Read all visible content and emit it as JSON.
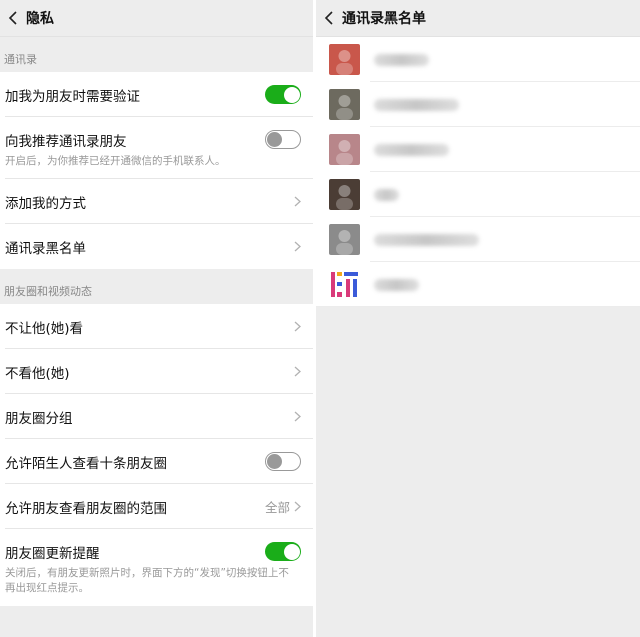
{
  "left": {
    "title": "隐私",
    "sections": [
      {
        "header": "通讯录",
        "rows": [
          {
            "label": "加我为朋友时需要验证",
            "toggle": "on"
          },
          {
            "label": "向我推荐通讯录朋友",
            "toggle": "off",
            "sub": "开启后，为你推荐已经开通微信的手机联系人。"
          },
          {
            "label": "添加我的方式",
            "chevron": true
          },
          {
            "label": "通讯录黑名单",
            "chevron": true
          }
        ]
      },
      {
        "header": "朋友圈和视频动态",
        "rows": [
          {
            "label": "不让他(她)看",
            "chevron": true
          },
          {
            "label": "不看他(她)",
            "chevron": true
          },
          {
            "label": "朋友圈分组",
            "chevron": true
          },
          {
            "label": "允许陌生人查看十条朋友圈",
            "toggle": "off"
          },
          {
            "label": "允许朋友查看朋友圈的范围",
            "value": "全部",
            "chevron": true
          },
          {
            "label": "朋友圈更新提醒",
            "toggle": "on",
            "sub": "关闭后，有朋友更新照片时，界面下方的“发现”切换按钮上不再出现红点提示。"
          }
        ]
      }
    ]
  },
  "right": {
    "title": "通讯录黑名单",
    "entries": [
      {
        "avatar_color": "#c9574b"
      },
      {
        "avatar_color": "#6d6a5f"
      },
      {
        "avatar_color": "#b8868a"
      },
      {
        "avatar_color": "#4b3d35"
      },
      {
        "avatar_color": "#8b8b8b"
      },
      {
        "avatar_color": "#d93a7a"
      }
    ]
  },
  "colors": {
    "toggle_on": "#1aad19",
    "background": "#ededed"
  }
}
